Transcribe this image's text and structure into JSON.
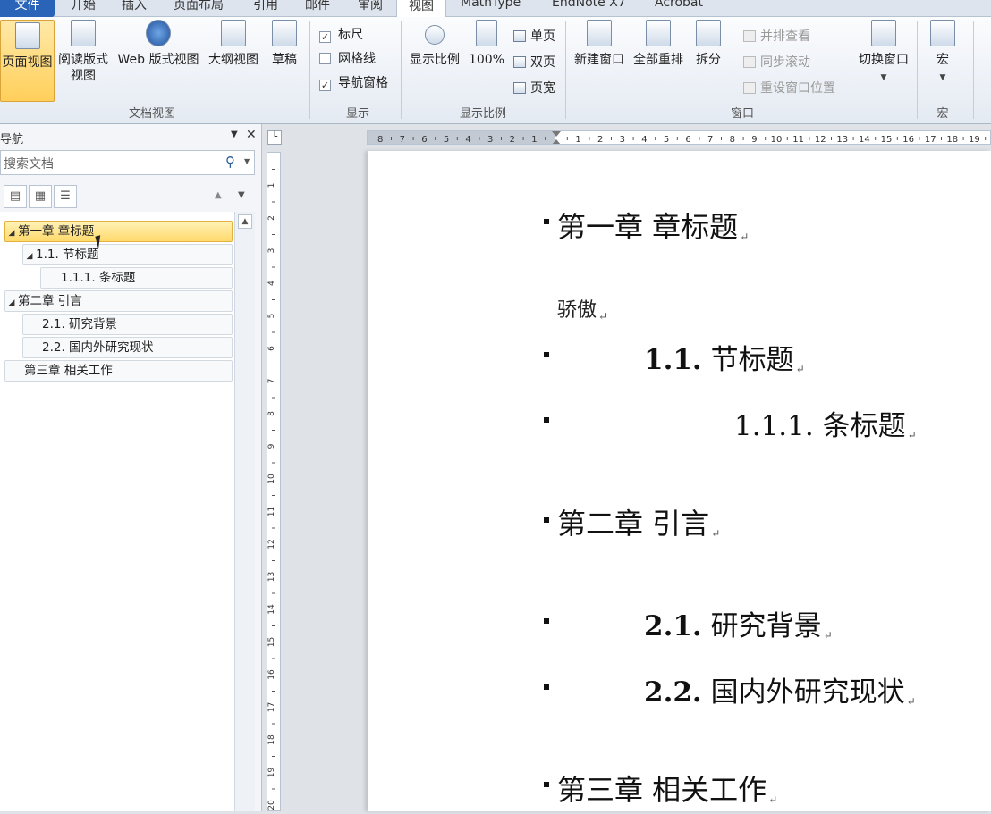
{
  "tabs": [
    {
      "label": "文件"
    },
    {
      "label": "开始"
    },
    {
      "label": "插入"
    },
    {
      "label": "页面布局"
    },
    {
      "label": "引用"
    },
    {
      "label": "邮件"
    },
    {
      "label": "审阅"
    },
    {
      "label": "视图"
    },
    {
      "label": "MathType"
    },
    {
      "label": "EndNote X7"
    },
    {
      "label": "Acrobat"
    }
  ],
  "ribbon": {
    "doc_views": {
      "group_label": "文档视图",
      "page_view": "页面视图",
      "reading_view_1": "阅读版式",
      "reading_view_2": "视图",
      "web_view": "Web 版式视图",
      "outline_view": "大纲视图",
      "draft_view": "草稿"
    },
    "show": {
      "group_label": "显示",
      "ruler": "标尺",
      "gridlines": "网格线",
      "nav_pane": "导航窗格"
    },
    "zoom": {
      "group_label": "显示比例",
      "zoom": "显示比例",
      "hundred": "100%",
      "one_page": "单页",
      "two_pages": "双页",
      "page_width": "页宽"
    },
    "window": {
      "group_label": "窗口",
      "new_window": "新建窗口",
      "arrange_all": "全部重排",
      "split": "拆分",
      "side_by_side": "并排查看",
      "sync_scroll": "同步滚动",
      "reset_position": "重设窗口位置",
      "switch_windows": "切换窗口"
    },
    "macros": {
      "group_label": "宏",
      "macros": "宏"
    }
  },
  "nav_pane": {
    "title": "导航",
    "search_placeholder": "搜索文档",
    "tree": [
      {
        "label": "第一章 章标题"
      },
      {
        "label": "1.1. 节标题"
      },
      {
        "label": "1.1.1. 条标题"
      },
      {
        "label": "第二章 引言"
      },
      {
        "label": "2.1. 研究背景"
      },
      {
        "label": "2.2. 国内外研究现状"
      },
      {
        "label": "第三章 相关工作"
      }
    ]
  },
  "document": {
    "h1_a": "第一章  章标题",
    "body_a": "骄傲",
    "h2_a_num": "1.1.",
    "h2_a_text": " 节标题",
    "h3_a": "1.1.1. 条标题",
    "h1_b": "第二章  引言",
    "h2_b_num": "2.1.",
    "h2_b_text": " 研究背景",
    "h2_c_num": "2.2.",
    "h2_c_text": " 国内外研究现状",
    "h1_c": "第三章  相关工作",
    "paragraph_mark": "↵"
  },
  "colors": {
    "file_tab": "#2a64b8",
    "selected_highlight": "#ffd96b"
  }
}
